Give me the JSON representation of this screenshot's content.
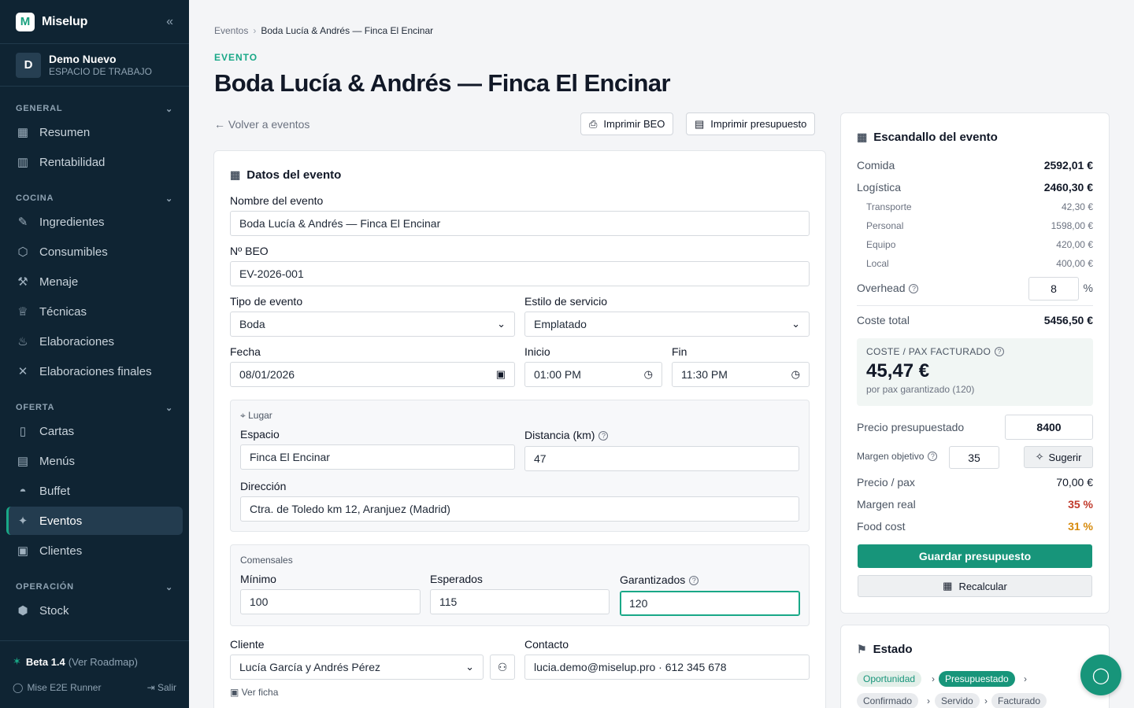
{
  "app": {
    "name": "Miselup",
    "logo_letter": "M",
    "collapse_icon": "«"
  },
  "workspace": {
    "avatar": "D",
    "name": "Demo Nuevo",
    "subtitle": "ESPACIO DE TRABAJO"
  },
  "sidebar": {
    "general": {
      "title": "GENERAL",
      "items": [
        {
          "label": "Resumen",
          "icon": "grid-icon"
        },
        {
          "label": "Rentabilidad",
          "icon": "bar-chart-icon"
        }
      ]
    },
    "cocina": {
      "title": "COCINA",
      "items": [
        {
          "label": "Ingredientes"
        },
        {
          "label": "Consumibles"
        },
        {
          "label": "Menaje"
        },
        {
          "label": "Técnicas"
        },
        {
          "label": "Elaboraciones"
        },
        {
          "label": "Elaboraciones finales"
        }
      ]
    },
    "oferta": {
      "title": "OFERTA",
      "items": [
        {
          "label": "Cartas"
        },
        {
          "label": "Menús"
        },
        {
          "label": "Buffet"
        },
        {
          "label": "Eventos",
          "active": true
        },
        {
          "label": "Clientes"
        }
      ]
    },
    "operacion": {
      "title": "OPERACIÓN",
      "items": [
        {
          "label": "Stock"
        }
      ]
    },
    "footer": {
      "beta": "Beta 1.4",
      "roadmap": "(Ver Roadmap)",
      "user": "Mise E2E Runner",
      "logout": "Salir"
    }
  },
  "breadcrumb": {
    "parent": "Eventos",
    "sep": "›",
    "current": "Boda Lucía & Andrés — Finca El Encinar"
  },
  "header": {
    "kicker": "EVENTO",
    "title": "Boda Lucía & Andrés — Finca El Encinar",
    "back": "Volver a eventos",
    "print_beo": "Imprimir BEO",
    "print_budget": "Imprimir presupuesto"
  },
  "form": {
    "section_title": "Datos del evento",
    "name_label": "Nombre del evento",
    "name_value": "Boda Lucía & Andrés — Finca El Encinar",
    "beo_label": "Nº BEO",
    "beo_value": "EV-2026-001",
    "type_label": "Tipo de evento",
    "type_value": "Boda",
    "style_label": "Estilo de servicio",
    "style_value": "Emplatado",
    "date_label": "Fecha",
    "date_value": "08/01/2026",
    "start_label": "Inicio",
    "start_value": "01:00 PM",
    "end_label": "Fin",
    "end_value": "11:30 PM",
    "place": {
      "title": "Lugar",
      "space_label": "Espacio",
      "space_value": "Finca El Encinar",
      "distance_label": "Distancia (km)",
      "distance_value": "47",
      "address_label": "Dirección",
      "address_value": "Ctra. de Toledo km 12, Aranjuez (Madrid)"
    },
    "guests": {
      "title": "Comensales",
      "min_label": "Mínimo",
      "min_value": "100",
      "expected_label": "Esperados",
      "expected_value": "115",
      "guaranteed_label": "Garantizados",
      "guaranteed_value": "120"
    },
    "client_label": "Cliente",
    "client_value": "Lucía García y Andrés Pérez",
    "contact_label": "Contacto",
    "contact_value": "lucia.demo@miselup.pro · 612 345 678",
    "view_file": "Ver ficha"
  },
  "cost": {
    "title": "Escandallo del evento",
    "food_label": "Comida",
    "food_value": "2592,01 €",
    "logistics_label": "Logística",
    "logistics_value": "2460,30 €",
    "transport_label": "Transporte",
    "transport_value": "42,30 €",
    "staff_label": "Personal",
    "staff_value": "1598,00 €",
    "equipment_label": "Equipo",
    "equipment_value": "420,00 €",
    "venue_label": "Local",
    "venue_value": "400,00 €",
    "overhead_label": "Overhead",
    "overhead_value": "8",
    "overhead_unit": "%",
    "total_label": "Coste total",
    "total_value": "5456,50 €",
    "pax_caption": "COSTE / PAX FACTURADO",
    "pax_value": "45,47 €",
    "pax_sub": "por pax garantizado (120)",
    "budget_label": "Precio presupuestado",
    "budget_value": "8400",
    "margin_target_label": "Margen objetivo",
    "margin_target_value": "35",
    "suggest": "Sugerir",
    "price_pax_label": "Precio / pax",
    "price_pax_value": "70,00 €",
    "real_margin_label": "Margen real",
    "real_margin_value": "35 %",
    "food_cost_label": "Food cost",
    "food_cost_value": "31 %",
    "save": "Guardar presupuesto",
    "recalc": "Recalcular"
  },
  "status": {
    "title": "Estado",
    "steps": [
      "Oportunidad",
      "Presupuestado",
      "Confirmado",
      "Servido",
      "Facturado"
    ]
  },
  "colors": {
    "sidebar_bg": "#0f2433",
    "accent": "#17957a",
    "danger": "#c0392b",
    "warning": "#d68a0c"
  }
}
